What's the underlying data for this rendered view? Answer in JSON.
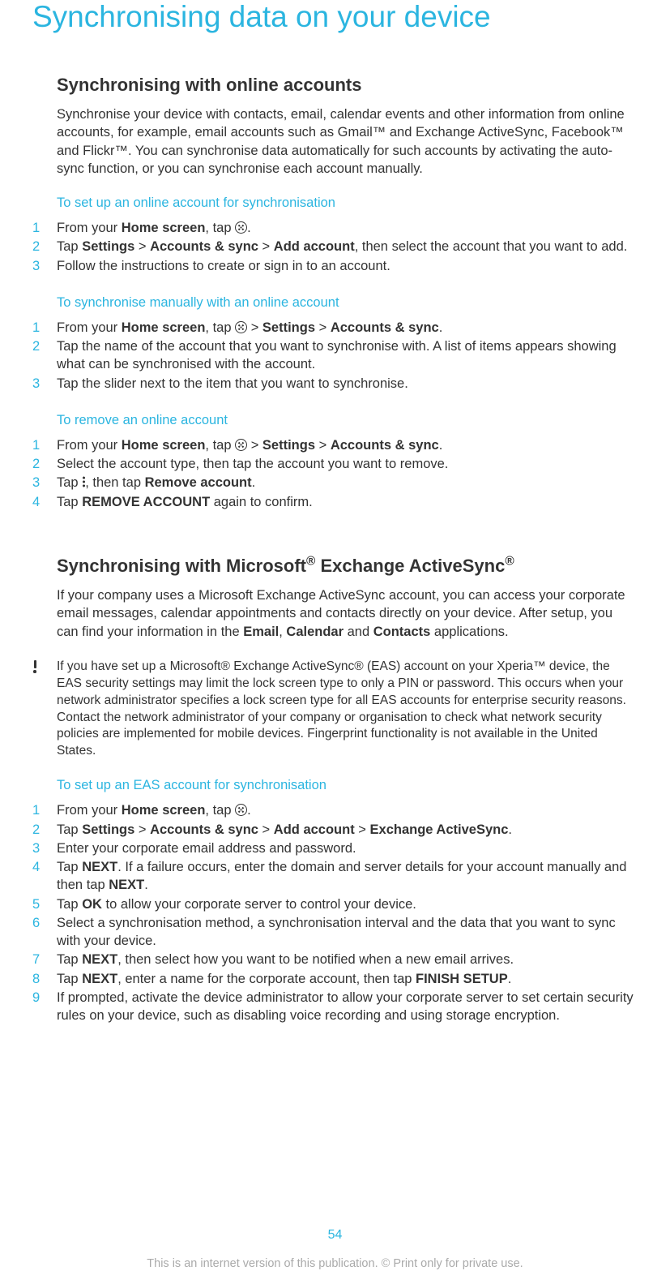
{
  "page": {
    "title": "Synchronising data on your device",
    "number": "54",
    "footer": "This is an internet version of this publication. © Print only for private use."
  },
  "section1": {
    "heading": "Synchronising with online accounts",
    "para": "Synchronise your device with contacts, email, calendar events and other information from online accounts, for example, email accounts such as Gmail™ and Exchange ActiveSync, Facebook™ and Flickr™. You can synchronise data automatically for such accounts by activating the auto-sync function, or you can synchronise each account manually."
  },
  "proc1": {
    "title": "To set up an online account for synchronisation",
    "s1a": "From your ",
    "s1b": "Home screen",
    "s1c": ", tap ",
    "s1d": ".",
    "s2a": "Tap ",
    "s2b": "Settings",
    "s2c": " > ",
    "s2d": "Accounts & sync",
    "s2e": " > ",
    "s2f": "Add account",
    "s2g": ", then select the account that you want to add.",
    "s3": "Follow the instructions to create or sign in to an account."
  },
  "proc2": {
    "title": "To synchronise manually with an online account",
    "s1a": "From your ",
    "s1b": "Home screen",
    "s1c": ", tap ",
    "s1d": " > ",
    "s1e": "Settings",
    "s1f": " > ",
    "s1g": "Accounts & sync",
    "s1h": ".",
    "s2": "Tap the name of the account that you want to synchronise with. A list of items appears showing what can be synchronised with the account.",
    "s3": "Tap the slider next to the item that you want to synchronise."
  },
  "proc3": {
    "title": "To remove an online account",
    "s1a": "From your ",
    "s1b": "Home screen",
    "s1c": ", tap ",
    "s1d": " > ",
    "s1e": "Settings",
    "s1f": " > ",
    "s1g": "Accounts & sync",
    "s1h": ".",
    "s2": "Select the account type, then tap the account you want to remove.",
    "s3a": "Tap ",
    "s3b": ", then tap ",
    "s3c": "Remove account",
    "s3d": ".",
    "s4a": "Tap ",
    "s4b": "REMOVE ACCOUNT",
    "s4c": " again to confirm."
  },
  "section2": {
    "heading_a": "Synchronising with Microsoft",
    "heading_b": " Exchange ActiveSync",
    "para_a": "If your company uses a Microsoft Exchange ActiveSync account, you can access your corporate email messages, calendar appointments and contacts directly on your device. After setup, you can find your information in the ",
    "para_b": "Email",
    "para_c": ", ",
    "para_d": "Calendar",
    "para_e": " and ",
    "para_f": "Contacts",
    "para_g": " applications.",
    "note": "If you have set up a Microsoft® Exchange ActiveSync® (EAS) account on your Xperia™ device, the EAS security settings may limit the lock screen type to only a PIN or password. This occurs when your network administrator specifies a lock screen type for all EAS accounts for enterprise security reasons. Contact the network administrator of your company or organisation to check what network security policies are implemented for mobile devices. Fingerprint functionality is not available in the United States."
  },
  "proc4": {
    "title": "To set up an EAS account for synchronisation",
    "s1a": "From your ",
    "s1b": "Home screen",
    "s1c": ", tap ",
    "s1d": ".",
    "s2a": "Tap ",
    "s2b": "Settings",
    "s2c": " > ",
    "s2d": "Accounts & sync",
    "s2e": " > ",
    "s2f": "Add account",
    "s2g": " > ",
    "s2h": "Exchange ActiveSync",
    "s2i": ".",
    "s3": "Enter your corporate email address and password.",
    "s4a": "Tap ",
    "s4b": "NEXT",
    "s4c": ". If a failure occurs, enter the domain and server details for your account manually and then tap ",
    "s4d": "NEXT",
    "s4e": ".",
    "s5a": "Tap ",
    "s5b": "OK",
    "s5c": " to allow your corporate server to control your device.",
    "s6": "Select a synchronisation method, a synchronisation interval and the data that you want to sync with your device.",
    "s7a": "Tap ",
    "s7b": "NEXT",
    "s7c": ", then select how you want to be notified when a new email arrives.",
    "s8a": "Tap ",
    "s8b": "NEXT",
    "s8c": ", enter a name for the corporate account, then tap ",
    "s8d": "FINISH SETUP",
    "s8e": ".",
    "s9": "If prompted, activate the device administrator to allow your corporate server to set certain security rules on your device, such as disabling voice recording and using storage encryption."
  },
  "nums": {
    "n1": "1",
    "n2": "2",
    "n3": "3",
    "n4": "4",
    "n5": "5",
    "n6": "6",
    "n7": "7",
    "n8": "8",
    "n9": "9"
  },
  "reg": "®"
}
